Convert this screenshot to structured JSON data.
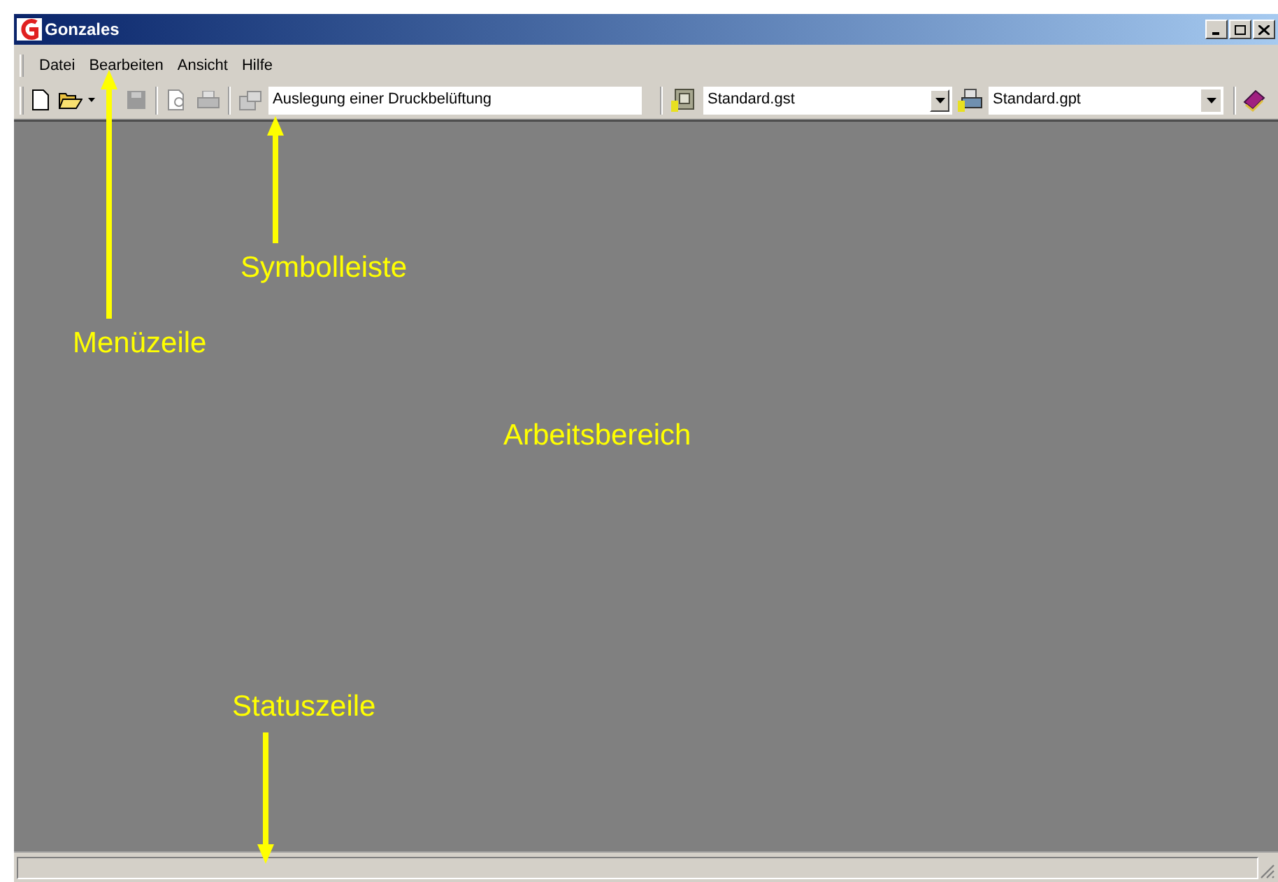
{
  "window": {
    "title": "Gonzales"
  },
  "menu": [
    {
      "label": "Datei"
    },
    {
      "label": "Bearbeiten"
    },
    {
      "label": "Ansicht"
    },
    {
      "label": "Hilfe"
    }
  ],
  "toolbar": {
    "project": {
      "value": "Auslegung einer Druckbelüftung"
    },
    "settings_file": {
      "value": "Standard.gst"
    },
    "profile_file": {
      "value": "Standard.gpt"
    }
  },
  "annotations": [
    {
      "text": "Symbolleiste",
      "kind": "up"
    },
    {
      "text": "Menüzeile",
      "kind": "up"
    },
    {
      "text": "Arbeitsbereich",
      "kind": "plain"
    },
    {
      "text": "Statuszeile",
      "kind": "down"
    }
  ]
}
